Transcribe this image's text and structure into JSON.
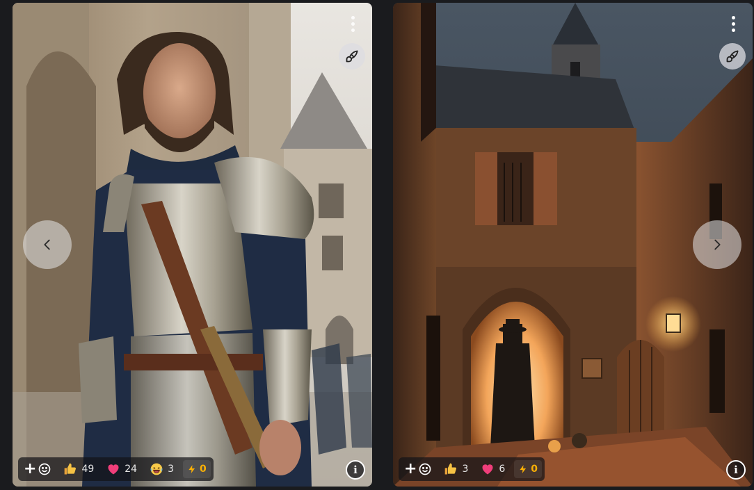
{
  "cards": [
    {
      "name": "knight-portrait",
      "reactions": {
        "like": "49",
        "heart": "24",
        "laugh": "3",
        "buzz": "0"
      }
    },
    {
      "name": "medieval-alley",
      "reactions": {
        "like": "3",
        "heart": "6",
        "buzz": "0"
      }
    }
  ],
  "icons": {
    "menu": "kebab-menu-icon",
    "remix": "brush-icon",
    "prev": "chevron-left-icon",
    "next": "chevron-right-icon",
    "add_reaction": "add-reaction-icon",
    "info": "info-icon"
  },
  "info_glyph": "i",
  "add_glyph": "+",
  "colors": {
    "buzz": "#fab005",
    "heart": "#f03e7a",
    "background": "#1a1b1e"
  }
}
